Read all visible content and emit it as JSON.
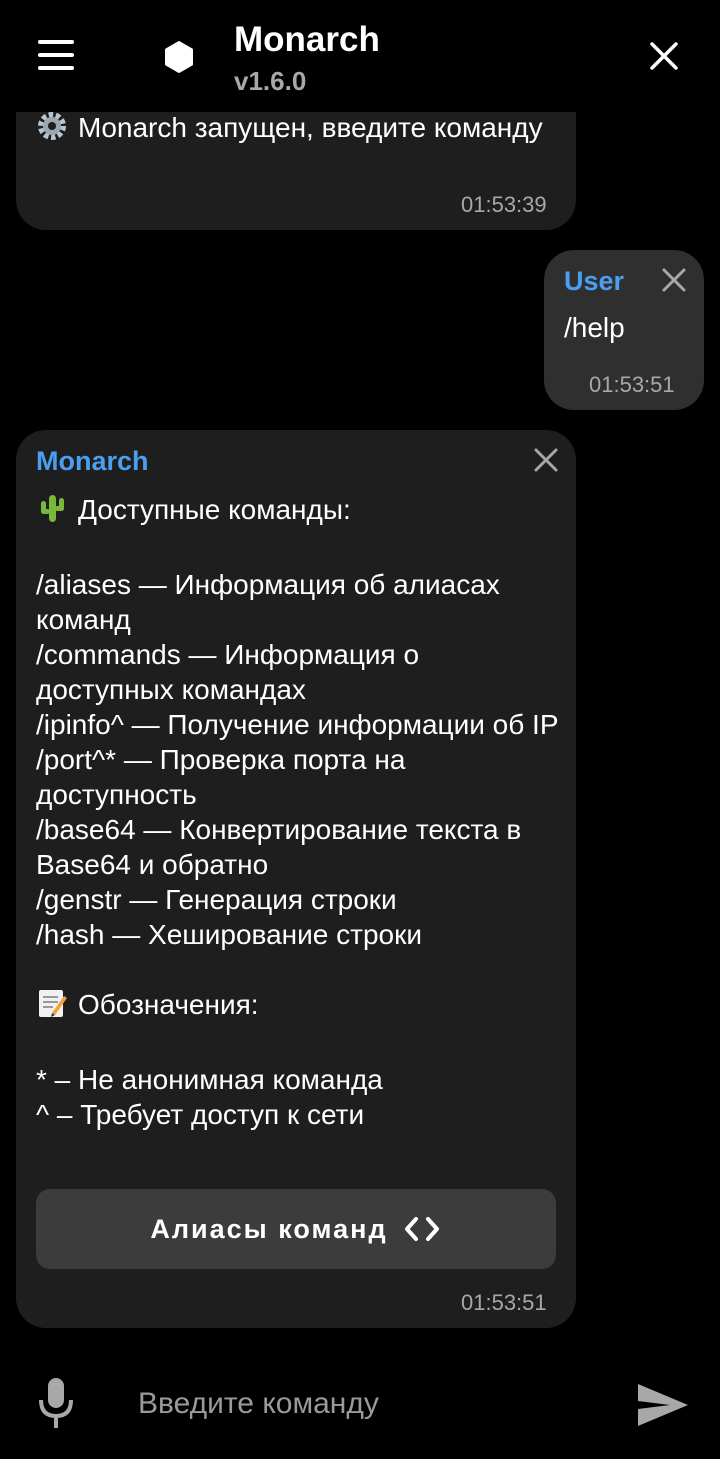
{
  "header": {
    "title": "Monarch",
    "version": "v1.6.0"
  },
  "messages": [
    {
      "text": "Monarch запущен, введите команду",
      "time": "01:53:39"
    },
    {
      "sender": "User",
      "text": "/help",
      "time": "01:53:51"
    },
    {
      "sender": "Monarch",
      "heading": "Доступные команды:",
      "commands": [
        "/aliases — Информация об алиасах команд",
        "/commands — Информация о доступных командах",
        "/ipinfo^ — Получение информации об IP",
        "/port^* — Проверка порта на доступность",
        "/base64 — Конвертирование текста в Base64 и обратно",
        "/genstr — Генерация строки",
        "/hash — Хеширование строки"
      ],
      "legend_heading": "Обозначения:",
      "legend": [
        "* – Не анонимная команда",
        "^ – Требует доступ к сети"
      ],
      "button_label": "Алиасы команд",
      "time": "01:53:51"
    }
  ],
  "input": {
    "placeholder": "Введите команду"
  },
  "icons": {
    "menu": "menu-icon",
    "logo": "hexagon-icon",
    "close": "close-icon",
    "gear": "gear-icon",
    "cactus": "cactus-icon",
    "memo": "memo-icon",
    "code": "code-icon",
    "mic": "microphone-icon",
    "send": "send-icon"
  },
  "colors": {
    "accent": "#4a9ff0",
    "bubble": "#1e1e1e",
    "user_bubble": "#2f2f2f",
    "button": "#3c3c3c"
  }
}
